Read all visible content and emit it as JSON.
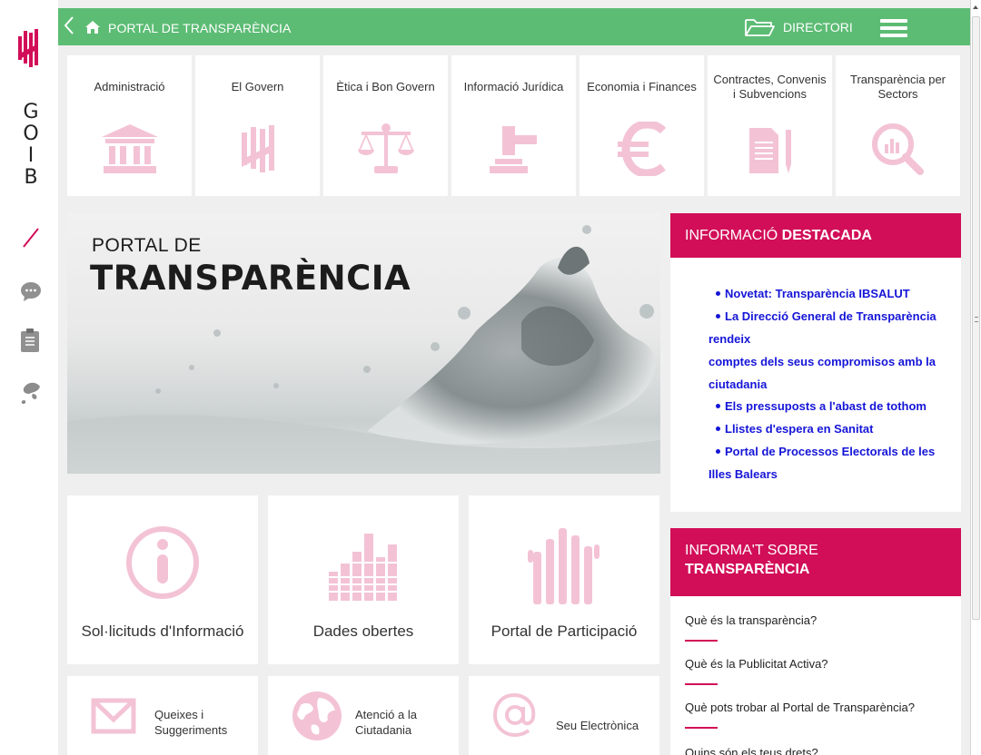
{
  "rail": {
    "brand_letters": [
      "G",
      "O",
      "I",
      "B"
    ]
  },
  "topbar": {
    "back_icon": "chevron-left-icon",
    "home_icon": "home-icon",
    "title": "PORTAL DE TRANSPARÈNCIA",
    "directory_label": "DIRECTORI",
    "menu_icon": "hamburger-icon"
  },
  "categories": [
    {
      "label": "Administració",
      "icon": "building-icon"
    },
    {
      "label": "El Govern",
      "icon": "government-logo-icon"
    },
    {
      "label": "Ètica i Bon Govern",
      "icon": "scales-icon"
    },
    {
      "label": "Informació Jurídica",
      "icon": "gavel-icon"
    },
    {
      "label": "Economia i Finances",
      "icon": "euro-icon"
    },
    {
      "label": "Contractes, Convenis i Subvencions",
      "icon": "document-pen-icon"
    },
    {
      "label": "Transparència per Sectors",
      "icon": "magnifier-chart-icon"
    }
  ],
  "hero": {
    "subtitle": "PORTAL DE",
    "title": "TRANSPARÈNCIA"
  },
  "destacada": {
    "title_normal": "INFORMACIÓ ",
    "title_bold": "DESTACADA",
    "items": [
      {
        "text": "Novetat: Transparència IBSALUT"
      },
      {
        "text": "La Direcció General de Transparència",
        "cont": [
          "rendeix",
          "comptes dels seus compromisos amb la",
          "ciutadania"
        ]
      },
      {
        "text": "Els pressuposts a l'abast de tothom"
      },
      {
        "text": "Llistes d'espera en Sanitat"
      },
      {
        "text": "Portal de Processos Electorals de les",
        "cont": [
          "Illes Balears"
        ]
      }
    ]
  },
  "informat": {
    "title_line1": "INFORMA'T SOBRE",
    "title_line2": "TRANSPARÈNCIA",
    "questions": [
      "Què és la transparència?",
      "Què és la Publicitat Activa?",
      "Què pots trobar al Portal de Transparència?",
      "Quins són els teus drets?"
    ]
  },
  "big_tiles": [
    {
      "label": "Sol·licituds d'Informació",
      "icon": "info-icon"
    },
    {
      "label": "Dades obertes",
      "icon": "bar-chart-icon"
    },
    {
      "label": "Portal de Participació",
      "icon": "raised-hands-icon"
    }
  ],
  "small_tiles": [
    {
      "line1": "Queixes i",
      "line2": "Suggeriments",
      "icon": "envelope-icon"
    },
    {
      "line1": "Atenció a la",
      "line2": "Ciutadania",
      "icon": "globe-icon"
    },
    {
      "line1": "Seu Electrònica",
      "line2": "",
      "icon": "at-sign-icon"
    }
  ],
  "colors": {
    "green_bar": "#5cbc74",
    "magenta": "#d20e58",
    "pink_icon": "#f3c3d5",
    "link_blue": "#1515d8"
  }
}
